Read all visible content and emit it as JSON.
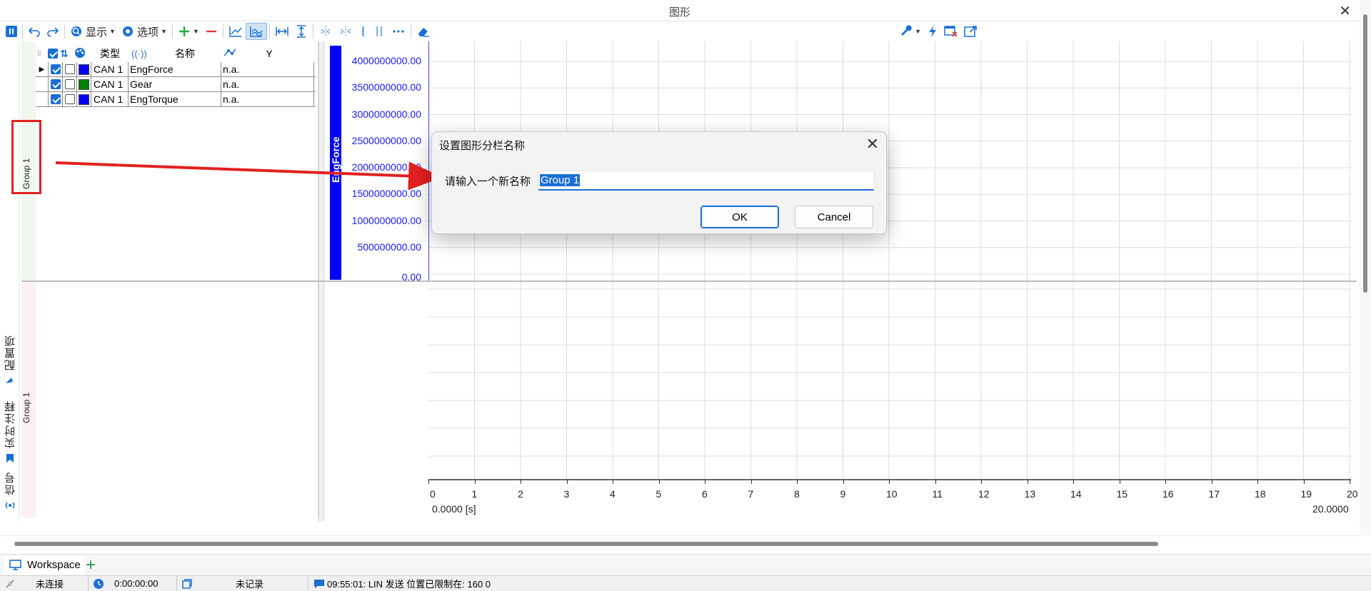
{
  "window": {
    "title": "图形"
  },
  "toolbar": {
    "display_label": "显示",
    "options_label": "选项"
  },
  "signal_table": {
    "headers": {
      "type": "类型",
      "name": "名称",
      "y": "Y"
    },
    "rows": [
      {
        "type": "CAN 1",
        "name": "EngForce",
        "value": "n.a.",
        "color": "#0000ff",
        "checked": true
      },
      {
        "type": "CAN 1",
        "name": "Gear",
        "value": "n.a.",
        "color": "#008000",
        "checked": true
      },
      {
        "type": "CAN 1",
        "name": "EngTorque",
        "value": "n.a.",
        "color": "#0000ff",
        "checked": true
      }
    ]
  },
  "groups": {
    "group1_label": "Group 1",
    "group2_label": "Group 1"
  },
  "side_tabs": {
    "config": "配置项",
    "annotations": "实时注释",
    "signals": "信号"
  },
  "chart_data": {
    "type": "line",
    "ylabel": "EngForce",
    "yticks": [
      "4000000000.00",
      "3500000000.00",
      "3000000000.00",
      "2500000000.00",
      "2000000000.00",
      "1500000000.00",
      "1000000000.00",
      "500000000.00",
      "0.00"
    ],
    "ylim": [
      0,
      4000000000
    ],
    "xticks": [
      "0",
      "1",
      "2",
      "3",
      "4",
      "5",
      "6",
      "7",
      "8",
      "9",
      "10",
      "11",
      "12",
      "13",
      "14",
      "15",
      "16",
      "17",
      "18",
      "19",
      "20"
    ],
    "xlim": [
      0,
      20
    ],
    "x_start_label": "0.0000 [s]",
    "x_end_label": "20.0000",
    "series": [],
    "grid": true
  },
  "dialog": {
    "title": "设置图形分栏名称",
    "prompt": "请输入一个新名称",
    "value": "Group 1",
    "ok": "OK",
    "cancel": "Cancel"
  },
  "workspace": {
    "tab": "Workspace"
  },
  "statusbar": {
    "connection": "未连接",
    "time": "0:00:00:00",
    "record": "未记录",
    "message": "09:55:01: LIN 发送 位置已限制在: 160 0"
  }
}
